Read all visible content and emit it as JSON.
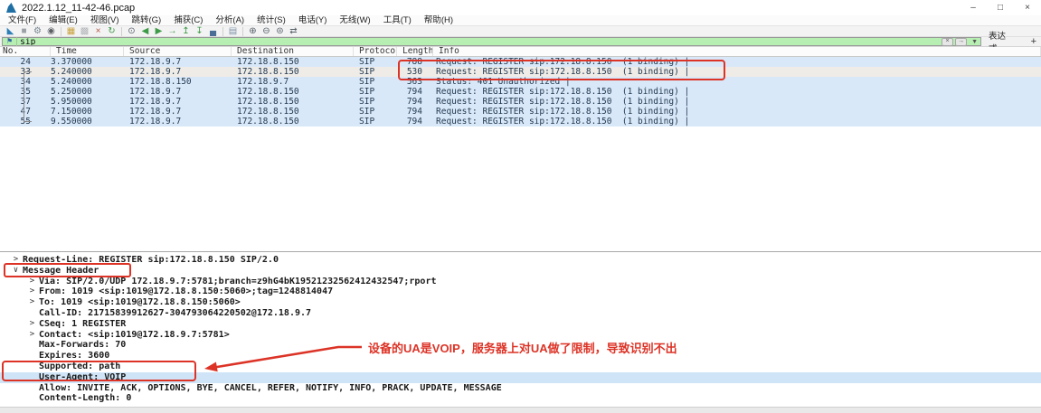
{
  "window": {
    "title": "2022.1.12_11-42-46.pcap",
    "controls": {
      "minimize": "–",
      "maximize": "□",
      "close": "×"
    }
  },
  "menu": {
    "items": [
      {
        "name": "file",
        "label": "文件(F)"
      },
      {
        "name": "edit",
        "label": "编辑(E)"
      },
      {
        "name": "view",
        "label": "视图(V)"
      },
      {
        "name": "go",
        "label": "跳转(G)"
      },
      {
        "name": "capture",
        "label": "捕获(C)"
      },
      {
        "name": "analyze",
        "label": "分析(A)"
      },
      {
        "name": "statistics",
        "label": "统计(S)"
      },
      {
        "name": "telephony",
        "label": "电话(Y)"
      },
      {
        "name": "wireless",
        "label": "无线(W)"
      },
      {
        "name": "tools",
        "label": "工具(T)"
      },
      {
        "name": "help",
        "label": "帮助(H)"
      }
    ]
  },
  "toolbar": {
    "icons": [
      {
        "name": "start-capture",
        "glyph": "◣",
        "color": "#2e7fb8"
      },
      {
        "name": "stop-capture",
        "glyph": "■",
        "color": "#9ba1a6"
      },
      {
        "name": "capture-options",
        "glyph": "⚙",
        "color": "#76858f"
      },
      {
        "name": "capture-filter",
        "glyph": "◉",
        "color": "#5c6066"
      },
      {
        "name": "separator"
      },
      {
        "name": "open-file",
        "glyph": "▦",
        "color": "#c9a13b"
      },
      {
        "name": "save-file",
        "glyph": "▩",
        "color": "#b0b4b8"
      },
      {
        "name": "close-file",
        "glyph": "×",
        "color": "#b05545"
      },
      {
        "name": "reload-file",
        "glyph": "↻",
        "color": "#3d9a46"
      },
      {
        "name": "separator"
      },
      {
        "name": "find-packet",
        "glyph": "⊙",
        "color": "#55606a"
      },
      {
        "name": "go-back",
        "glyph": "◀",
        "color": "#3d9a46"
      },
      {
        "name": "go-forward",
        "glyph": "▶",
        "color": "#3d9a46"
      },
      {
        "name": "go-to-packet",
        "glyph": "→",
        "color": "#3d9a46"
      },
      {
        "name": "go-to-top",
        "glyph": "↥",
        "color": "#3d9a46"
      },
      {
        "name": "go-to-bottom",
        "glyph": "↧",
        "color": "#3d9a46"
      },
      {
        "name": "auto-scroll",
        "glyph": "▄",
        "color": "#4a6e96"
      },
      {
        "name": "separator"
      },
      {
        "name": "colorize",
        "glyph": "▤",
        "color": "#7d93a8"
      },
      {
        "name": "separator"
      },
      {
        "name": "zoom-in",
        "glyph": "⊕",
        "color": "#55606a"
      },
      {
        "name": "zoom-out",
        "glyph": "⊖",
        "color": "#55606a"
      },
      {
        "name": "zoom-reset",
        "glyph": "⊜",
        "color": "#55606a"
      },
      {
        "name": "resize-columns",
        "glyph": "⇄",
        "color": "#55606a"
      }
    ]
  },
  "filter": {
    "value": "sip",
    "clear_glyph": "×",
    "apply_glyph": "→",
    "dropdown_glyph": "▼",
    "bookmark_glyph": "⚑",
    "expression_label": "表达式…",
    "add_label": "+"
  },
  "packet_list": {
    "columns": [
      {
        "key": "no",
        "label": "No."
      },
      {
        "key": "time",
        "label": "Time"
      },
      {
        "key": "source",
        "label": "Source"
      },
      {
        "key": "destination",
        "label": "Destination"
      },
      {
        "key": "protocol",
        "label": "Protocol"
      },
      {
        "key": "length",
        "label": "Length"
      },
      {
        "key": "info",
        "label": "Info"
      }
    ],
    "rows": [
      {
        "no": "24",
        "time": "3.370000",
        "source": "172.18.9.7",
        "destination": "172.18.8.150",
        "protocol": "SIP",
        "length": "788",
        "info": "Request: REGISTER sip:172.18.8.150  (1 binding) |",
        "selected": false
      },
      {
        "no": "33",
        "time": "5.240000",
        "source": "172.18.9.7",
        "destination": "172.18.8.150",
        "protocol": "SIP",
        "length": "530",
        "info": "Request: REGISTER sip:172.18.8.150  (1 binding) |",
        "selected": true
      },
      {
        "no": "34",
        "time": "5.240000",
        "source": "172.18.8.150",
        "destination": "172.18.9.7",
        "protocol": "SIP",
        "length": "563",
        "info": "Status: 401 Unauthorized |",
        "selected": false
      },
      {
        "no": "35",
        "time": "5.250000",
        "source": "172.18.9.7",
        "destination": "172.18.8.150",
        "protocol": "SIP",
        "length": "794",
        "info": "Request: REGISTER sip:172.18.8.150  (1 binding) |",
        "selected": false
      },
      {
        "no": "37",
        "time": "5.950000",
        "source": "172.18.9.7",
        "destination": "172.18.8.150",
        "protocol": "SIP",
        "length": "794",
        "info": "Request: REGISTER sip:172.18.8.150  (1 binding) |",
        "selected": false
      },
      {
        "no": "47",
        "time": "7.150000",
        "source": "172.18.9.7",
        "destination": "172.18.8.150",
        "protocol": "SIP",
        "length": "794",
        "info": "Request: REGISTER sip:172.18.8.150  (1 binding) |",
        "selected": false
      },
      {
        "no": "55",
        "time": "9.550000",
        "source": "172.18.9.7",
        "destination": "172.18.8.150",
        "protocol": "SIP",
        "length": "794",
        "info": "Request: REGISTER sip:172.18.8.150  (1 binding) |",
        "selected": false
      }
    ]
  },
  "details": {
    "lines": [
      {
        "indent": 0,
        "expander": ">",
        "text": "Request-Line: REGISTER sip:172.18.8.150 SIP/2.0",
        "selected": false
      },
      {
        "indent": 0,
        "expander": "v",
        "text": "Message Header",
        "selected": false
      },
      {
        "indent": 1,
        "expander": ">",
        "text": "Via: SIP/2.0/UDP 172.18.9.7:5781;branch=z9hG4bK19521232562412432547;rport",
        "selected": false
      },
      {
        "indent": 1,
        "expander": ">",
        "text": "From: 1019 <sip:1019@172.18.8.150:5060>;tag=1248814047",
        "selected": false
      },
      {
        "indent": 1,
        "expander": ">",
        "text": "To: 1019 <sip:1019@172.18.8.150:5060>",
        "selected": false
      },
      {
        "indent": 1,
        "expander": "",
        "text": "Call-ID: 21715839912627-304793064220502@172.18.9.7",
        "selected": false
      },
      {
        "indent": 1,
        "expander": ">",
        "text": "CSeq: 1 REGISTER",
        "selected": false
      },
      {
        "indent": 1,
        "expander": ">",
        "text": "Contact: <sip:1019@172.18.9.7:5781>",
        "selected": false
      },
      {
        "indent": 1,
        "expander": "",
        "text": "Max-Forwards: 70",
        "selected": false
      },
      {
        "indent": 1,
        "expander": "",
        "text": "Expires: 3600",
        "selected": false
      },
      {
        "indent": 1,
        "expander": "",
        "text": "Supported: path",
        "selected": false
      },
      {
        "indent": 1,
        "expander": "",
        "text": "User-Agent: VOIP",
        "selected": true
      },
      {
        "indent": 1,
        "expander": "",
        "text": "Allow: INVITE, ACK, OPTIONS, BYE, CANCEL, REFER, NOTIFY, INFO, PRACK, UPDATE, MESSAGE",
        "selected": false
      },
      {
        "indent": 1,
        "expander": "",
        "text": "Content-Length: 0",
        "selected": false
      }
    ]
  },
  "annotation": {
    "text": "设备的UA是VOIP，服务器上对UA做了限制，导致识别不出"
  },
  "colors": {
    "annotation_red": "#dc3326",
    "row_sip_bg": "#d9e8f8",
    "row_selected_bg": "#efece7",
    "detail_selected_bg": "#cfe5f7",
    "filter_valid_bg": "#b7efb3"
  }
}
